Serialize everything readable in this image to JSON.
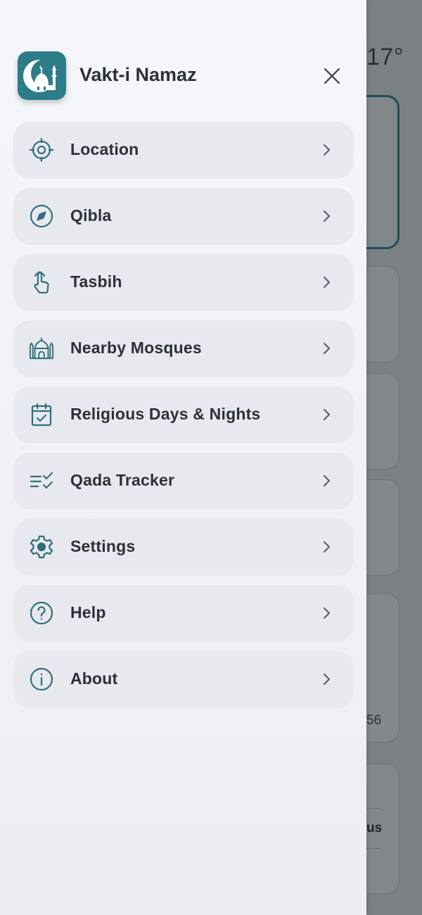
{
  "app": {
    "title": "Vakt-i Namaz",
    "brand_color": "#2c7d89",
    "icon_color": "#2f6f7b"
  },
  "background": {
    "temperature": "17°",
    "partial_number": "56",
    "partial_word": "us"
  },
  "menu": {
    "items": [
      {
        "label": "Location",
        "icon": "location-target-icon"
      },
      {
        "label": "Qibla",
        "icon": "compass-icon"
      },
      {
        "label": "Tasbih",
        "icon": "tap-hand-icon"
      },
      {
        "label": "Nearby Mosques",
        "icon": "mosque-icon"
      },
      {
        "label": "Religious Days & Nights",
        "icon": "calendar-check-icon"
      },
      {
        "label": "Qada Tracker",
        "icon": "checklist-icon"
      },
      {
        "label": "Settings",
        "icon": "gear-icon"
      },
      {
        "label": "Help",
        "icon": "help-circle-icon"
      },
      {
        "label": "About",
        "icon": "info-circle-icon"
      }
    ]
  }
}
